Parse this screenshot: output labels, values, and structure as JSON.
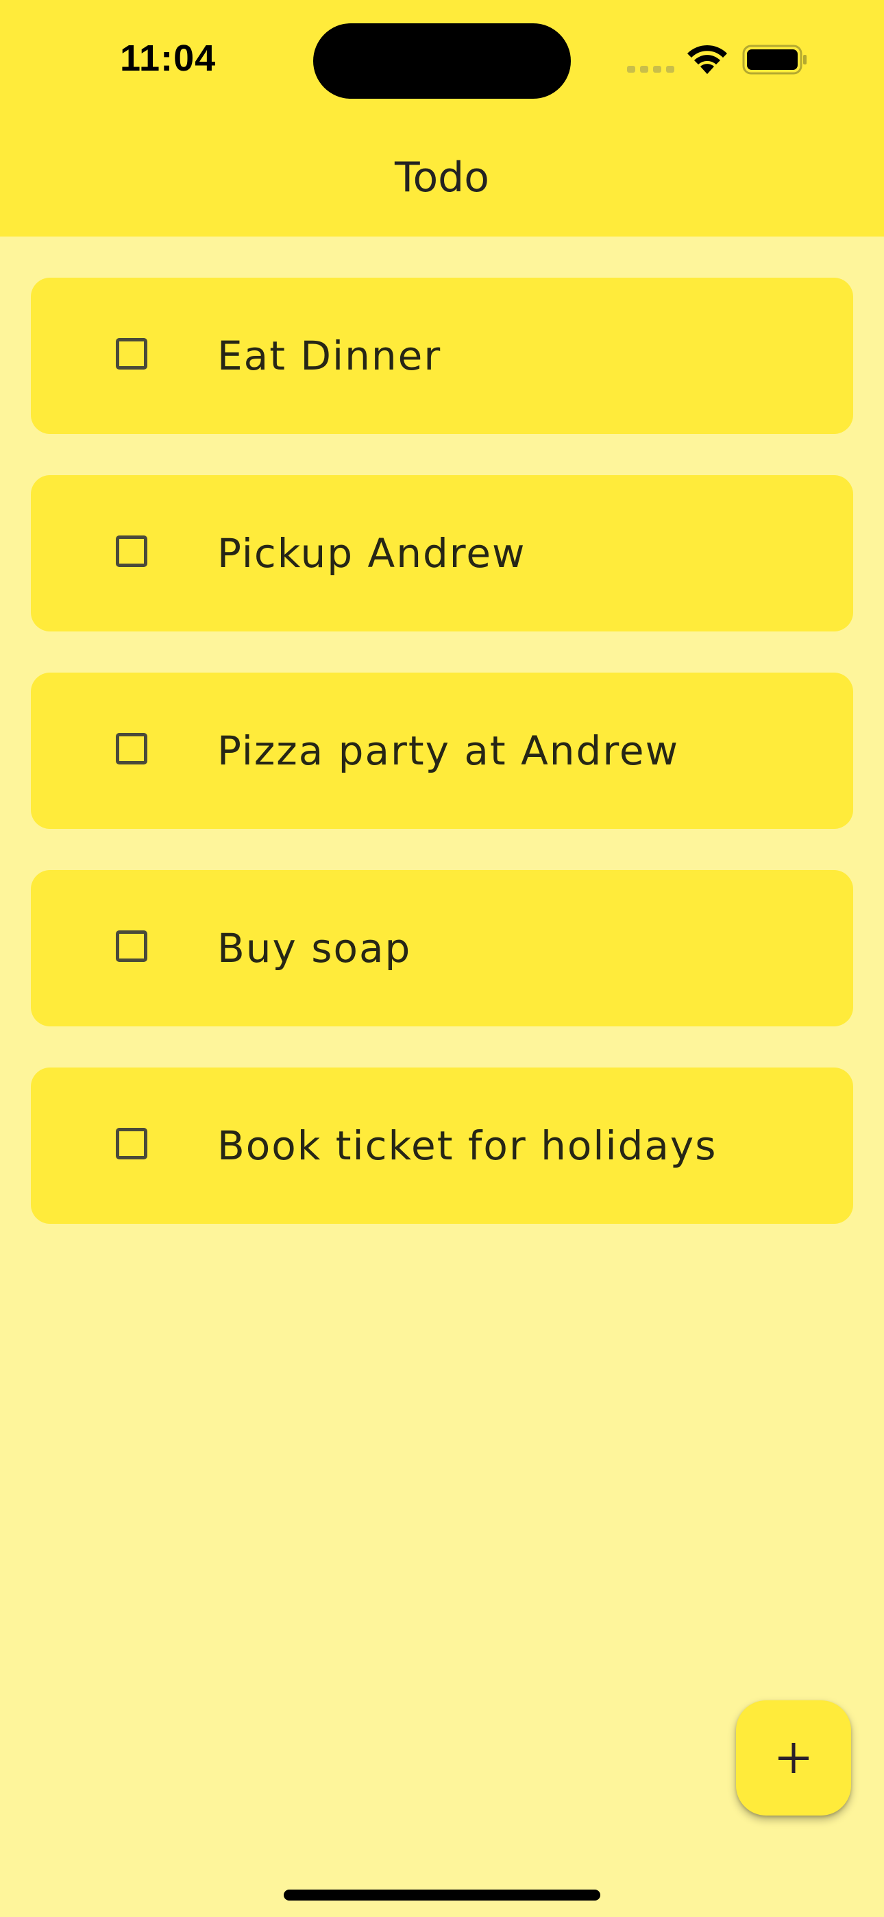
{
  "status_bar": {
    "time": "11:04",
    "icons": [
      "signal-icon",
      "wifi-icon",
      "battery-icon"
    ]
  },
  "app_bar": {
    "title": "Todo"
  },
  "todos": [
    {
      "label": "Eat Dinner",
      "checked": false
    },
    {
      "label": "Pickup Andrew",
      "checked": false
    },
    {
      "label": "Pizza party at Andrew",
      "checked": false
    },
    {
      "label": "Buy soap",
      "checked": false
    },
    {
      "label": "Book ticket for holidays",
      "checked": false
    }
  ],
  "fab": {
    "icon": "plus-icon"
  },
  "colors": {
    "accent": "#FFEB3B",
    "background": "#FEF59B",
    "text": "#262616"
  }
}
